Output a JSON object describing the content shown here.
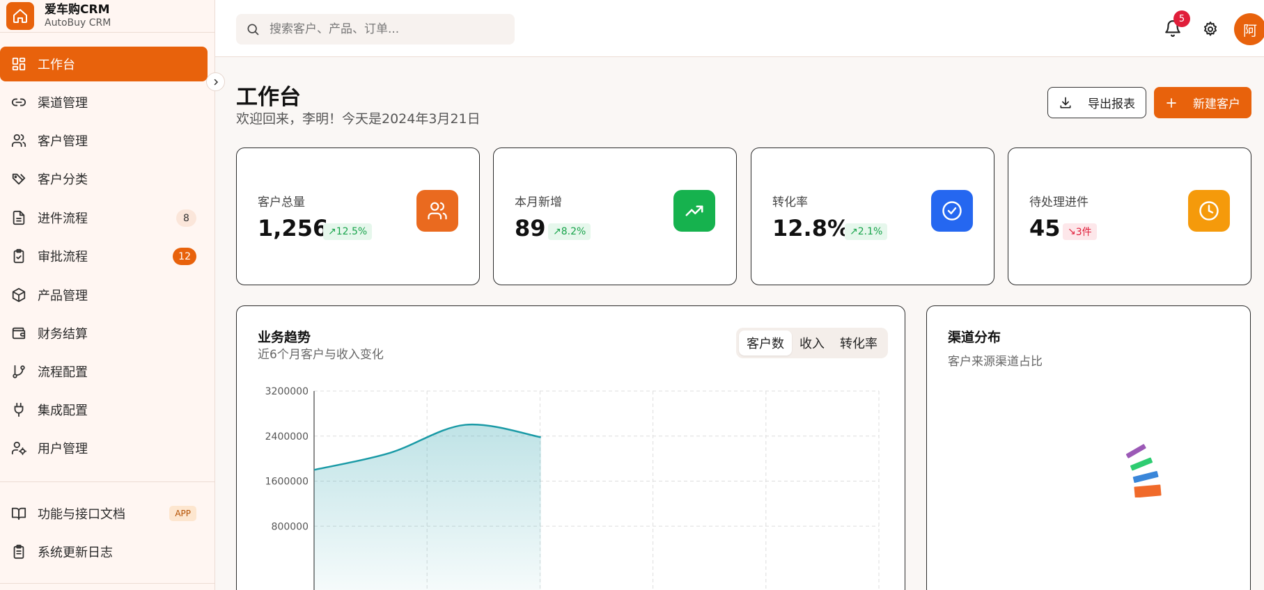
{
  "brand": {
    "name": "爱车购CRM",
    "subtitle": "AutoBuy CRM"
  },
  "sidebar": {
    "items": [
      {
        "label": "工作台",
        "icon": "dashboard-icon",
        "active": true
      },
      {
        "label": "渠道管理",
        "icon": "link-icon"
      },
      {
        "label": "客户管理",
        "icon": "users-icon"
      },
      {
        "label": "客户分类",
        "icon": "tags-icon"
      },
      {
        "label": "进件流程",
        "icon": "file-text-icon",
        "badge": "8"
      },
      {
        "label": "审批流程",
        "icon": "clipboard-check-icon",
        "badge": "12"
      },
      {
        "label": "产品管理",
        "icon": "package-icon"
      },
      {
        "label": "财务结算",
        "icon": "wallet-icon"
      },
      {
        "label": "流程配置",
        "icon": "git-branch-icon"
      },
      {
        "label": "集成配置",
        "icon": "plug-icon"
      },
      {
        "label": "用户管理",
        "icon": "user-cog-icon"
      }
    ],
    "footer_items": [
      {
        "label": "功能与接口文档",
        "icon": "book-open-icon",
        "badge": "APP"
      },
      {
        "label": "系统更新日志",
        "icon": "clipboard-list-icon"
      }
    ]
  },
  "header": {
    "search_placeholder": "搜索客户、产品、订单...",
    "notification_count": "5",
    "avatar_text": "阿"
  },
  "page": {
    "title": "工作台",
    "subtitle": "欢迎回来，李明！今天是2024年3月21日",
    "export_label": "导出报表",
    "new_customer_label": "新建客户"
  },
  "stats": [
    {
      "label": "客户总量",
      "value": "1,256",
      "delta": "12.5%",
      "trend": "up",
      "icon": "users-icon",
      "color": "#ea6a1f"
    },
    {
      "label": "本月新增",
      "value": "89",
      "delta": "8.2%",
      "trend": "up",
      "icon": "trending-up-icon",
      "color": "#16b24e"
    },
    {
      "label": "转化率",
      "value": "12.8%",
      "delta": "2.1%",
      "trend": "up",
      "icon": "check-circle-icon",
      "color": "#2567f0"
    },
    {
      "label": "待处理进件",
      "value": "45",
      "delta": "3件",
      "trend": "down",
      "icon": "clock-icon",
      "color": "#f59a0b"
    }
  ],
  "trend_panel": {
    "title": "业务趋势",
    "subtitle": "近6个月客户与收入变化",
    "tabs": [
      "客户数",
      "收入",
      "转化率"
    ],
    "active_tab": "客户数"
  },
  "channel_panel": {
    "title": "渠道分布",
    "subtitle": "客户来源渠道占比"
  },
  "chart_data": {
    "type": "area",
    "y_ticks": [
      "3200000",
      "2400000",
      "1600000",
      "800000"
    ],
    "ylim": [
      0,
      3200000
    ],
    "series": [
      {
        "values": [
          1800000,
          2100000,
          2600000,
          2380000
        ]
      }
    ],
    "x_slots": 5,
    "grid": true,
    "line_color": "#1a9aa6"
  }
}
